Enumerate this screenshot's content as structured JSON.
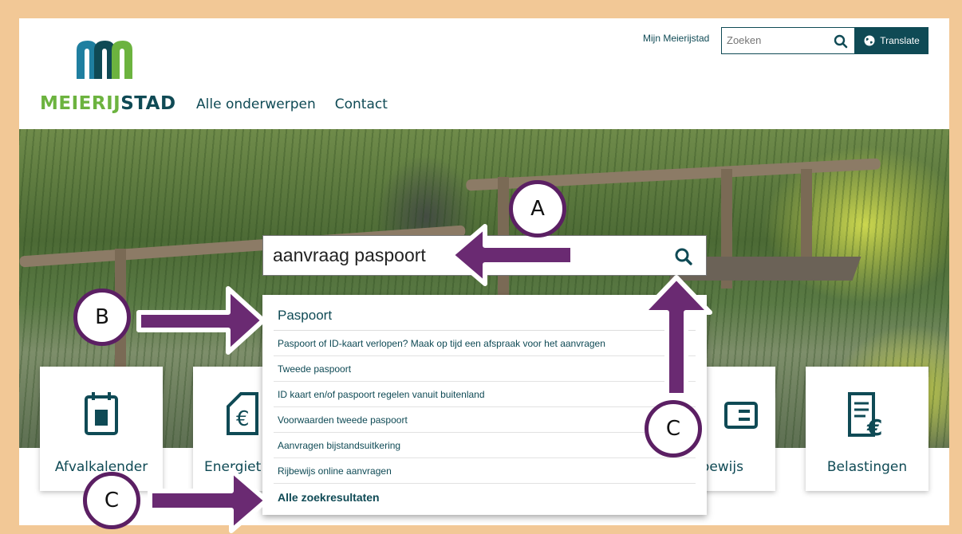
{
  "header": {
    "logo_text_1": "MEIERIJ",
    "logo_text_2": "STAD",
    "nav": [
      "Alle onderwerpen",
      "Contact"
    ],
    "mijn_link": "Mijn Meierijstad",
    "search_placeholder": "Zoeken",
    "translate_label": "Translate"
  },
  "main_search": {
    "value": "aanvraag paspoort"
  },
  "dropdown": {
    "heading": "Paspoort",
    "items": [
      "Paspoort of ID-kaart verlopen? Maak op tijd een afspraak voor het aanvragen",
      "Tweede paspoort",
      "ID kaart en/of paspoort regelen vanuit buitenland",
      "Voorwaarden tweede paspoort",
      "Aanvragen bijstandsuitkering",
      "Rijbewijs online aanvragen"
    ],
    "all_results": "Alle zoekresultaten"
  },
  "tiles": {
    "afvalkalender": "Afvalkalender",
    "energie": "Energiet",
    "rijbewijs": "bewijs",
    "belastingen": "Belastingen"
  },
  "annotations": {
    "a": "A",
    "b": "B",
    "c1": "C",
    "c2": "C"
  },
  "colors": {
    "brand_dark": "#0f4a55",
    "brand_green": "#6cb33f",
    "arrow_purple": "#6a2a72",
    "frame": "#f2c896"
  }
}
